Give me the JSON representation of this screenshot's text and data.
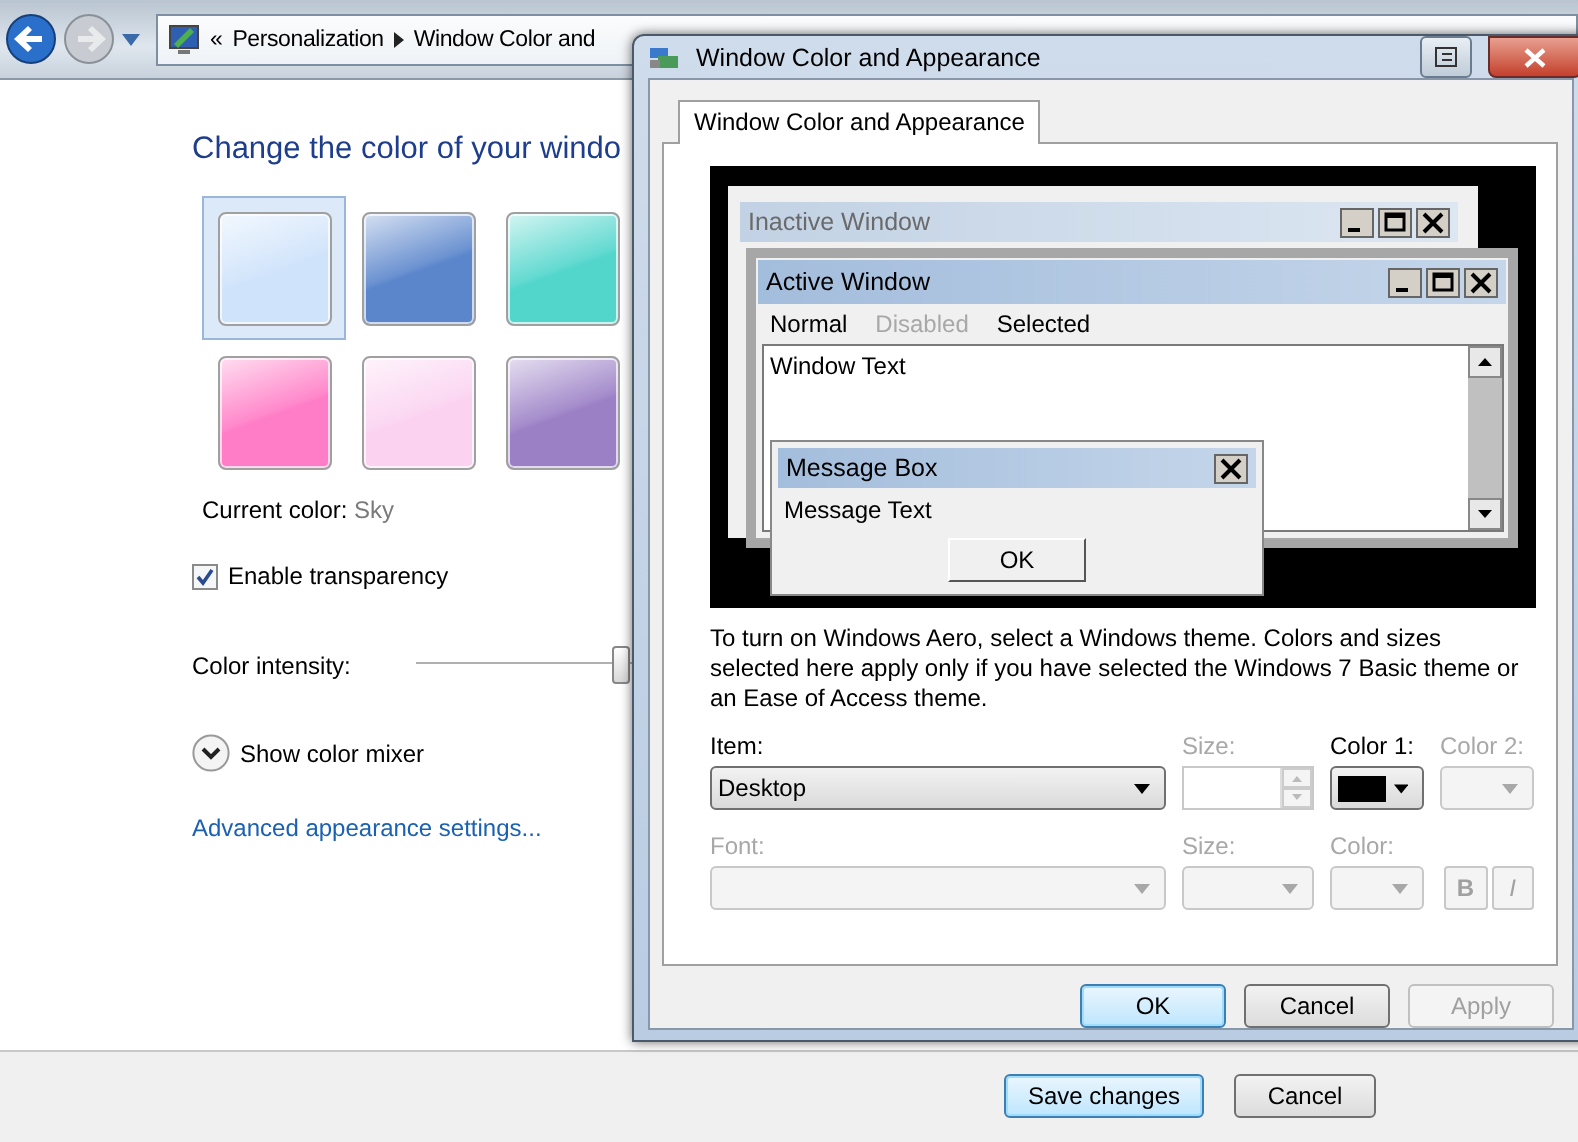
{
  "address_bar": {
    "chevron": "«",
    "path": [
      {
        "label": "Personalization"
      },
      {
        "label": "Window Color and"
      }
    ]
  },
  "heading": "Change the color of your windo",
  "swatches": [
    {
      "color": "#cfe3fb",
      "selected": true
    },
    {
      "color": "#5b86cc",
      "selected": false
    },
    {
      "color": "#52d6cc",
      "selected": false
    },
    {
      "color": "#ff7cc6",
      "selected": false
    },
    {
      "color": "#fbd3f1",
      "selected": false
    },
    {
      "color": "#9b80c6",
      "selected": false
    }
  ],
  "current_color": {
    "label": "Current color:",
    "value": "Sky"
  },
  "transparency": {
    "label": "Enable transparency",
    "checked": true
  },
  "intensity": {
    "label": "Color intensity:",
    "level": 0.85
  },
  "color_mixer": {
    "label": "Show color mixer",
    "expanded": false
  },
  "advanced_link": "Advanced appearance settings...",
  "footer_buttons": [
    {
      "label": "Save changes",
      "default": true
    },
    {
      "label": "Cancel",
      "default": false
    }
  ],
  "dialog": {
    "title": "Window Color and Appearance",
    "tabs": [
      {
        "label": "Window Color and Appearance",
        "selected": true
      }
    ],
    "preview": {
      "inactive_title": "Inactive Window",
      "active_title": "Active Window",
      "menu": [
        {
          "label": "Normal",
          "disabled": false
        },
        {
          "label": "Disabled",
          "disabled": true
        },
        {
          "label": "Selected",
          "disabled": false
        }
      ],
      "window_text": "Window Text",
      "message_box": {
        "title": "Message Box",
        "text": "Message Text",
        "button": "OK"
      }
    },
    "note": "To turn on Windows Aero, select a Windows theme.  Colors and sizes selected here apply only if you have selected the Windows 7 Basic theme or an Ease of Access theme.",
    "fields": [
      {
        "label": "Item:",
        "kind": "dropdown",
        "disabled": false,
        "value": "Desktop"
      },
      {
        "label": "Size:",
        "kind": "spin",
        "disabled": true
      },
      {
        "label": "Color 1:",
        "kind": "color",
        "disabled": false,
        "color": "#000000"
      },
      {
        "label": "Color 2:",
        "kind": "color",
        "disabled": true
      },
      {
        "label": "Font:",
        "kind": "dropdown",
        "disabled": true
      },
      {
        "label": "Size:",
        "kind": "dropdown",
        "disabled": true
      },
      {
        "label": "Color:",
        "kind": "color",
        "disabled": true
      },
      {
        "kind": "styles",
        "buttons": [
          {
            "label": "B",
            "disabled": true
          },
          {
            "label": "I",
            "disabled": true
          }
        ]
      }
    ],
    "buttons": [
      {
        "label": "OK",
        "default": true,
        "disabled": false
      },
      {
        "label": "Cancel",
        "default": false,
        "disabled": false
      },
      {
        "label": "Apply",
        "default": false,
        "disabled": true
      }
    ]
  }
}
